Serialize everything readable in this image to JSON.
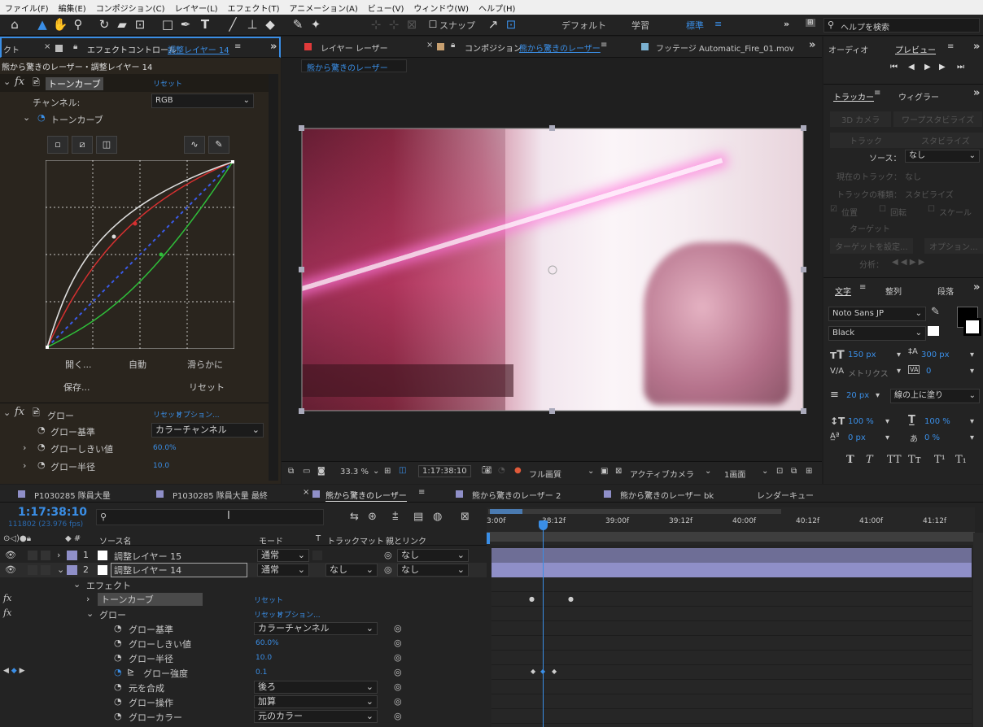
{
  "menu": [
    "ファイル(F)",
    "編集(E)",
    "コンポジション(C)",
    "レイヤー(L)",
    "エフェクト(T)",
    "アニメーション(A)",
    "ビュー(V)",
    "ウィンドウ(W)",
    "ヘルプ(H)"
  ],
  "toolbar": {
    "snap": "スナップ",
    "workspaces": [
      "デフォルト",
      "学習",
      "標準"
    ],
    "search_placeholder": "ヘルプを検索"
  },
  "effect_panel": {
    "tab_prefix": "クト",
    "tab_title": "エフェクトコントロール",
    "tab_target": "調整レイヤー 14",
    "subtitle": "熊から驚きのレーザー・調整レイヤー 14",
    "curves": {
      "name": "トーンカーブ",
      "reset": "リセット",
      "channel_label": "チャンネル:",
      "channel_value": "RGB",
      "sub": "トーンカーブ",
      "btn_open": "開く...",
      "btn_auto": "自動",
      "btn_smooth": "滑らかに",
      "btn_save": "保存...",
      "btn_reset": "リセット"
    },
    "glow": {
      "name": "グロー",
      "reset": "リセット",
      "options": "オプション...",
      "base_label": "グロー基準",
      "base_value": "カラーチャンネル",
      "thr_label": "グローしきい値",
      "thr_value": "60.0%",
      "rad_label": "グロー半径",
      "rad_value": "10.0"
    }
  },
  "comp_panel": {
    "tab_layer": "レイヤー レーザー",
    "tab_comp_prefix": "コンポジション",
    "tab_comp": "熊から驚きのレーザー",
    "tab_footage": "フッテージ Automatic_Fire_01.mov",
    "crumb": "熊から驚きのレーザー",
    "footer": {
      "zoom": "33.3 %",
      "time": "1:17:38:10",
      "quality": "フル画質",
      "camera": "アクティブカメラ",
      "views": "1画面"
    }
  },
  "right_panel": {
    "tab_audio": "オーディオ",
    "tab_preview": "プレビュー",
    "tab_tracker": "トラッカー",
    "tab_wiggler": "ウィグラー",
    "tracker": {
      "btn_3d": "3D カメラ",
      "btn_warp": "ワープスタビライズ",
      "btn_track": "トラック",
      "btn_stab": "スタビライズ",
      "source_label": "ソース：",
      "source_value": "なし",
      "current_label": "現在のトラック：",
      "current_value": "なし",
      "type_label": "トラックの種類：",
      "type_value": "スタビライズ",
      "chk_pos": "位置",
      "chk_rot": "回転",
      "chk_scale": "スケール",
      "target": "ターゲット",
      "set_target": "ターゲットを設定...",
      "options": "オプション...",
      "analyze": "分析："
    },
    "char": {
      "tab_char": "文字",
      "tab_align": "整列",
      "tab_para": "段落",
      "font": "Noto Sans JP",
      "style": "Black",
      "size": "150 px",
      "leading": "300 px",
      "kern": "メトリクス",
      "track": "0",
      "stroke": "20 px",
      "stroke_mode": "線の上に塗り",
      "vscale": "100 %",
      "hscale": "100 %",
      "baseline": "0 px",
      "tsume": "0 %",
      "styles": [
        "T",
        "T",
        "TT",
        "Tт",
        "T¹",
        "T₁"
      ]
    }
  },
  "timeline": {
    "tabs": [
      "P1030285 隊員大量",
      "P1030285 隊員大量 最終",
      "熊から驚きのレーザー",
      "熊から驚きのレーザー 2",
      "熊から驚きのレーザー bk",
      "レンダーキュー"
    ],
    "timecode": "1:17:38:10",
    "fps": "111802 (23.976 fps)",
    "search_placeholder": "",
    "headers": {
      "source": "ソース名",
      "mode": "モード",
      "t": "T",
      "matte": "トラックマット",
      "parent": "親とリンク"
    },
    "ruler": [
      "3:00f",
      "38:12f",
      "39:00f",
      "39:12f",
      "40:00f",
      "40:12f",
      "41:00f",
      "41:12f"
    ],
    "layers": [
      {
        "num": "1",
        "name": "調整レイヤー 15",
        "mode": "通常",
        "parent": "なし"
      },
      {
        "num": "2",
        "name": "調整レイヤー 14",
        "mode": "通常",
        "matte": "なし",
        "parent": "なし"
      }
    ],
    "effects_label": "エフェクト",
    "curves_label": "トーンカーブ",
    "curves_reset": "リセット",
    "glow_label": "グロー",
    "glow_reset": "リセット",
    "glow_options": "オプション...",
    "props": [
      {
        "name": "グロー基準",
        "value": "カラーチャンネル",
        "kind": "dd"
      },
      {
        "name": "グローしきい値",
        "value": "60.0%",
        "kind": "num"
      },
      {
        "name": "グロー半径",
        "value": "10.0",
        "kind": "num"
      },
      {
        "name": "グロー強度",
        "value": "0.1",
        "kind": "num"
      },
      {
        "name": "元を合成",
        "value": "後ろ",
        "kind": "dd"
      },
      {
        "name": "グロー操作",
        "value": "加算",
        "kind": "dd"
      },
      {
        "name": "グローカラー",
        "value": "元のカラー",
        "kind": "dd"
      }
    ]
  },
  "colors": {
    "accent": "#3a8ee6",
    "label_red": "#e03a3a",
    "label_lavender": "#8f8fc8",
    "label_purple": "#8b6fc0"
  }
}
